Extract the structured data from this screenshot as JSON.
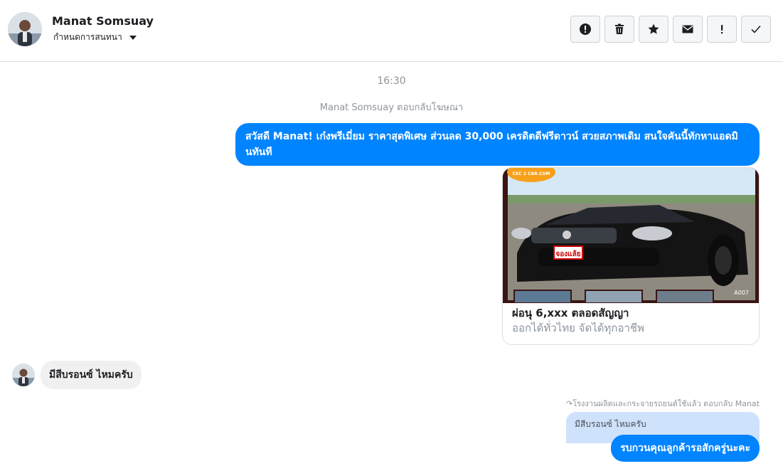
{
  "header": {
    "contact_name": "Manat Somsuay",
    "status_label": "กำหนดการสนทนา",
    "toolbar": [
      {
        "name": "spam-button",
        "icon": "alert-circle-icon"
      },
      {
        "name": "delete-button",
        "icon": "trash-icon"
      },
      {
        "name": "star-button",
        "icon": "star-icon"
      },
      {
        "name": "mark-unread-button",
        "icon": "envelope-icon"
      },
      {
        "name": "important-button",
        "icon": "exclamation-icon"
      },
      {
        "name": "done-button",
        "icon": "checkmark-icon"
      }
    ]
  },
  "thread": {
    "timestamp": "16:30",
    "ad_reply_meta": "Manat Somsuay ตอบกลับโฆษณา",
    "outgoing_message": "สวัสดี Manat! เก๋งพรีเมี่ยม ราคาสุดพิเศษ ส่วนลด 30,000 เครดิตดีฟรีดาวน์ สวยสภาพเดิม สนใจคันนี้ทักหาแอดมินทันที",
    "card": {
      "title": "ผ่อนุ 6,xxx ตลอดสัญญา",
      "subtitle": "ออกได้ทั่วไทย จัดได้ทุกอาชีพ",
      "image_logo_text": "CKC 2 CAR.COM",
      "image_plate_text": "จองแล้ย",
      "image_code": "A007"
    },
    "incoming_message": "มีสีบรอนซ์ ไหมครับ",
    "reply_meta": "โรงงานผลิตและกระจายรถยนต์ใช้แล้ว ตอบกลับ Manat",
    "quoted_message": "มีสีบรอนซ์ ไหมครับ",
    "reply_message": "รบกวนคุณลูกค้ารอสักครู่นะคะ"
  },
  "colors": {
    "accent": "#0084ff",
    "incoming_bubble": "#f1f0f0",
    "quoted_bubble": "#cfe2fb",
    "muted_text": "#90949c"
  }
}
